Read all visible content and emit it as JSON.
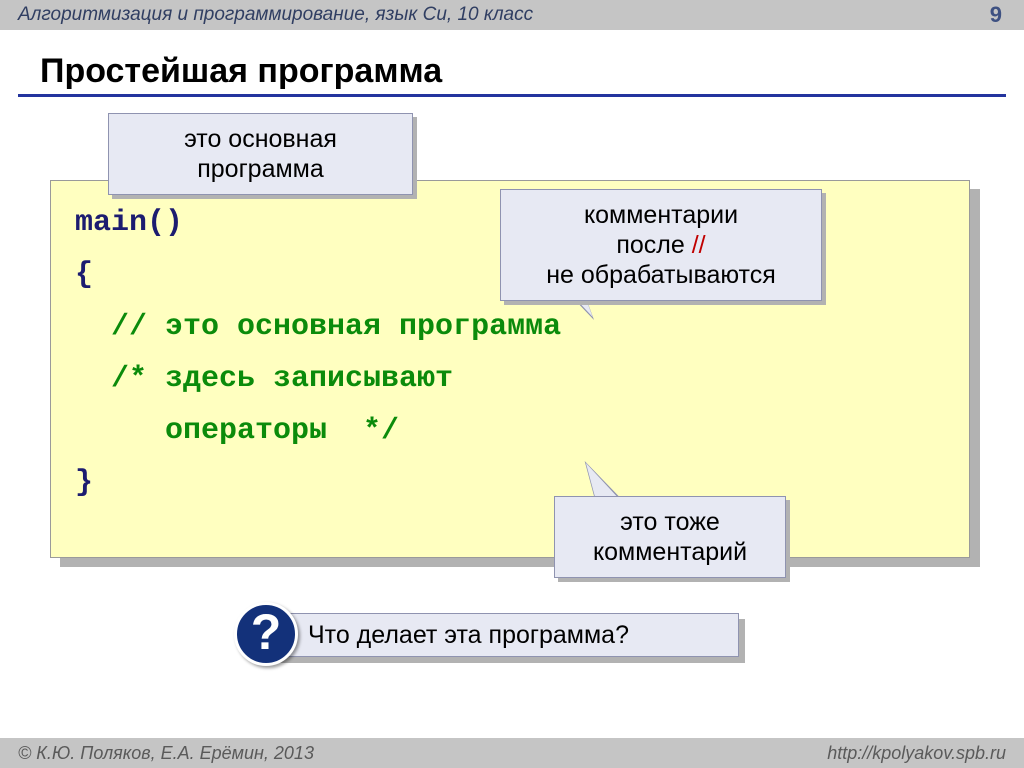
{
  "header": {
    "title": "Алгоритмизация и программирование, язык Си, 10 класс",
    "page": "9"
  },
  "heading": "Простейшая программа",
  "code": {
    "l1": "main()",
    "l2": "{",
    "l3": "  // это основная программа",
    "l4": "  /* здесь записывают",
    "l5": "     операторы  */",
    "l6": "}"
  },
  "callouts": {
    "co1": "это основная программа",
    "co2_line1": "комментарии",
    "co2_line2a": "после ",
    "co2_line2b": "//",
    "co2_line3": "не обрабатываются",
    "co3_line1": "это тоже",
    "co3_line2": "комментарий"
  },
  "question": {
    "badge": "?",
    "text": "Что делает эта программа?"
  },
  "footer": {
    "left": "© К.Ю. Поляков, Е.А. Ерёмин, 2013",
    "right": "http://kpolyakov.spb.ru"
  }
}
